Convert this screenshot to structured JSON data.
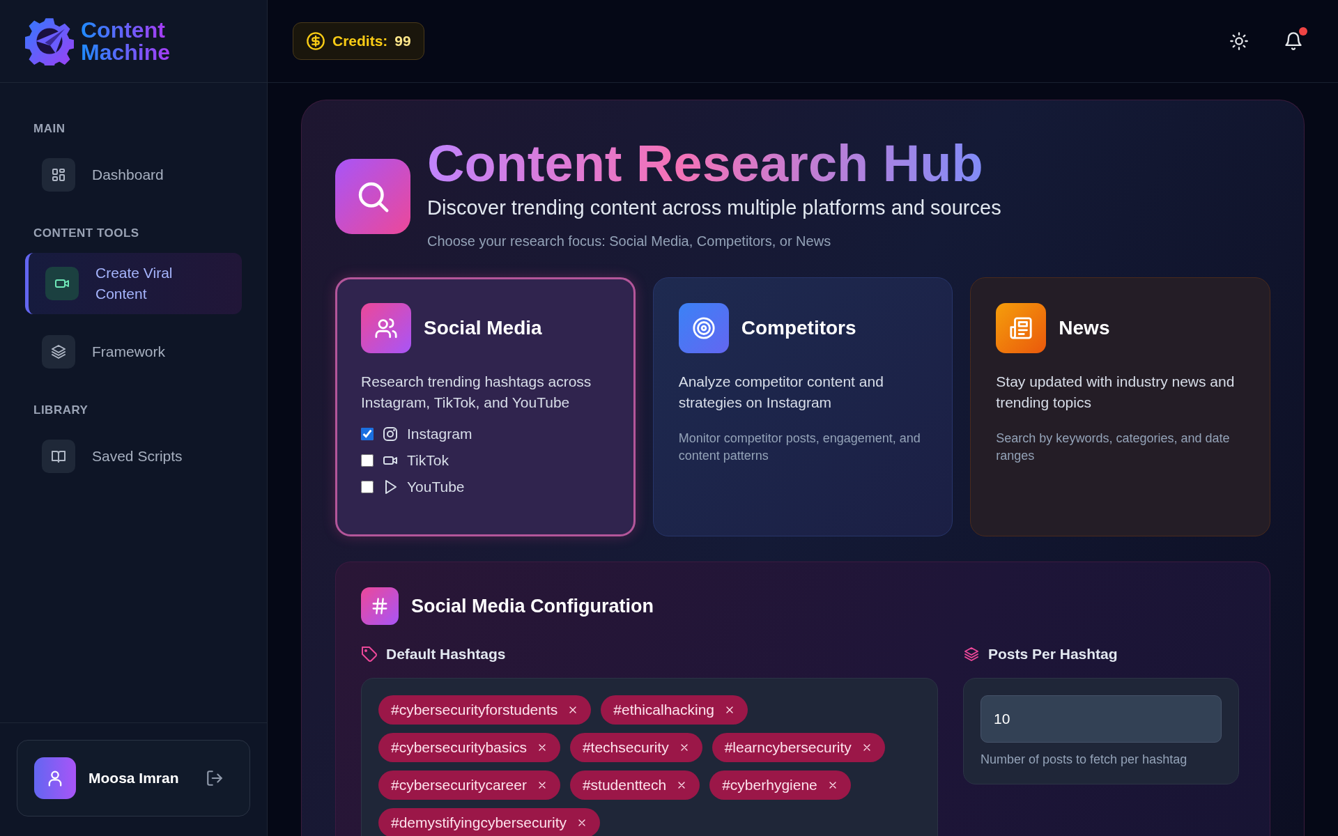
{
  "sidebar": {
    "logo": {
      "line_1": "Content",
      "line_2": "Machine"
    },
    "sections": [
      {
        "label": "MAIN",
        "items": [
          {
            "label": "Dashboard",
            "kind": "grid",
            "selected": false
          }
        ]
      },
      {
        "label": "CONTENT TOOLS",
        "items": [
          {
            "label": "Create Viral Content",
            "kind": "video",
            "selected": true
          },
          {
            "label": "Framework",
            "kind": "layers",
            "selected": false
          }
        ]
      },
      {
        "label": "LIBRARY",
        "items": [
          {
            "label": "Saved Scripts",
            "kind": "book",
            "selected": false
          }
        ]
      }
    ],
    "user": {
      "name": "Moosa Imran"
    }
  },
  "header": {
    "credits": {
      "label": "Credits:",
      "value": "99"
    },
    "notifications": {
      "unread": true
    }
  },
  "hub": {
    "title": "Content Research Hub",
    "subtitle": "Discover trending content across multiple platforms and sources",
    "hint": "Choose your research focus: Social Media, Competitors, or News"
  },
  "cards": [
    {
      "kind": "social",
      "title": "Social Media",
      "selected": true,
      "description": "Research trending hashtags across Instagram, TikTok, and YouTube",
      "options": [
        {
          "kind": "instagram",
          "label": "Instagram",
          "checked": true
        },
        {
          "kind": "tiktok",
          "label": "TikTok",
          "checked": false
        },
        {
          "kind": "youtube",
          "label": "YouTube",
          "checked": false
        }
      ]
    },
    {
      "kind": "competitors",
      "title": "Competitors",
      "selected": false,
      "description": "Analyze competitor content and strategies on Instagram",
      "note": "Monitor competitor posts, engagement, and content patterns"
    },
    {
      "kind": "news",
      "title": "News",
      "selected": false,
      "description": "Stay updated with industry news and trending topics",
      "note": "Search by keywords, categories, and date ranges"
    }
  ],
  "config": {
    "title": "Social Media Configuration",
    "hashtags_label": "Default Hashtags",
    "hashtags": [
      "#cybersecurityforstudents",
      "#ethicalhacking",
      "#cybersecuritybasics",
      "#techsecurity",
      "#learncybersecurity",
      "#cybersecuritycareer",
      "#studenttech",
      "#cyberhygiene",
      "#demystifyingcybersecurity"
    ],
    "posts_label": "Posts Per Hashtag",
    "posts_value": "10",
    "posts_help": "Number of posts to fetch per hashtag"
  }
}
